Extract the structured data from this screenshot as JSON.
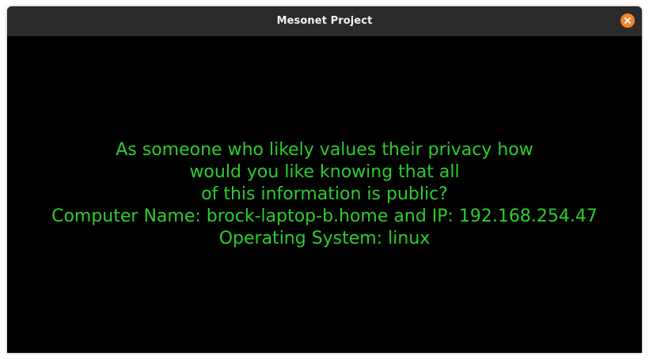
{
  "window": {
    "title": "Mesonet Project"
  },
  "message": {
    "lines": [
      "As someone who likely values their privacy how",
      "would you like knowing that all",
      "of this information is public?",
      "Computer Name: brock-laptop-b.home and IP: 192.168.254.47",
      "Operating System: linux"
    ]
  },
  "colors": {
    "text": "#2ecc2e",
    "background": "#000000",
    "titlebar": "#2b2b2b",
    "close_button": "#f0862f"
  },
  "icons": {
    "close": "close-icon"
  }
}
